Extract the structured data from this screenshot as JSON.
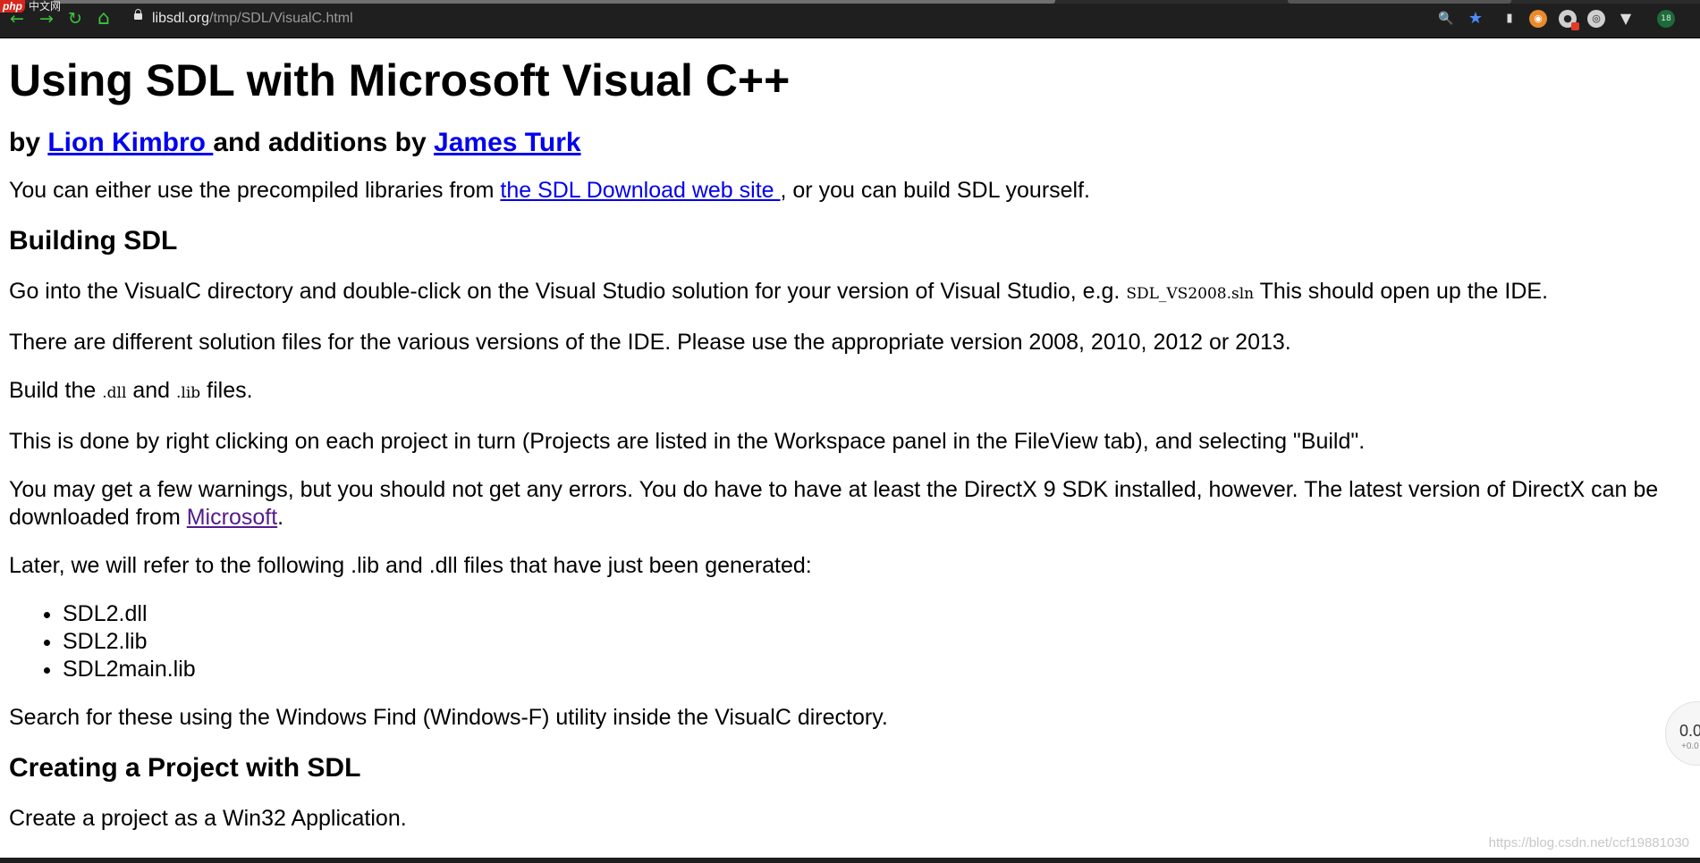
{
  "browser": {
    "php_logo": "php",
    "php_site": "中文网",
    "url_host": "libsdl.org",
    "url_path": "/tmp/SDL/VisualC.html",
    "icons": {
      "back": "←",
      "forward": "→",
      "reload": "↻",
      "home": "⌂",
      "zoom": "🔍",
      "bookmark_star": "★",
      "ext_a": "▮",
      "ext_b": "◉",
      "ext_c": "●",
      "ext_d": "◎",
      "ext_e": "▼",
      "profile": "18"
    },
    "accent_green": "#3ec23e",
    "star_color": "#4d8cff"
  },
  "page": {
    "title": "Using SDL with Microsoft Visual C++",
    "byline": {
      "by": "by ",
      "author1": "Lion Kimbro ",
      "and": "and additions by ",
      "author2": "James Turk"
    },
    "intro": {
      "pre": "You can either use the precompiled libraries from ",
      "link": "the SDL Download web site ",
      "post": ", or you can build SDL yourself."
    },
    "building_heading": "Building SDL",
    "p1": {
      "pre": "Go into the VisualC directory and double-click on the Visual Studio solution for your version of Visual Studio, e.g. ",
      "code": "SDL_VS2008.sln",
      "post": " This should open up the IDE."
    },
    "p2": "There are different solution files for the various versions of the IDE. Please use the appropriate version 2008, 2010, 2012 or 2013.",
    "p3": {
      "pre": "Build the ",
      "code1": ".dll",
      "mid": " and ",
      "code2": ".lib",
      "post": " files."
    },
    "p4": "This is done by right clicking on each project in turn (Projects are listed in the Workspace panel in the FileView tab), and selecting \"Build\".",
    "p5": {
      "pre": "You may get a few warnings, but you should not get any errors. You do have to have at least the DirectX 9 SDK installed, however. The latest version of DirectX can be downloaded from ",
      "link": "Microsoft",
      "post": "."
    },
    "p6": "Later, we will refer to the following .lib and .dll files that have just been generated:",
    "files": [
      "SDL2.dll",
      "SDL2.lib",
      "SDL2main.lib"
    ],
    "p7": "Search for these using the Windows Find (Windows-F) utility inside the VisualC directory.",
    "creating_heading": "Creating a Project with SDL",
    "p8": "Create a project as a Win32 Application."
  },
  "widget": {
    "value": "0.0",
    "delta": "+0.0"
  },
  "watermark": "https://blog.csdn.net/ccf19881030"
}
